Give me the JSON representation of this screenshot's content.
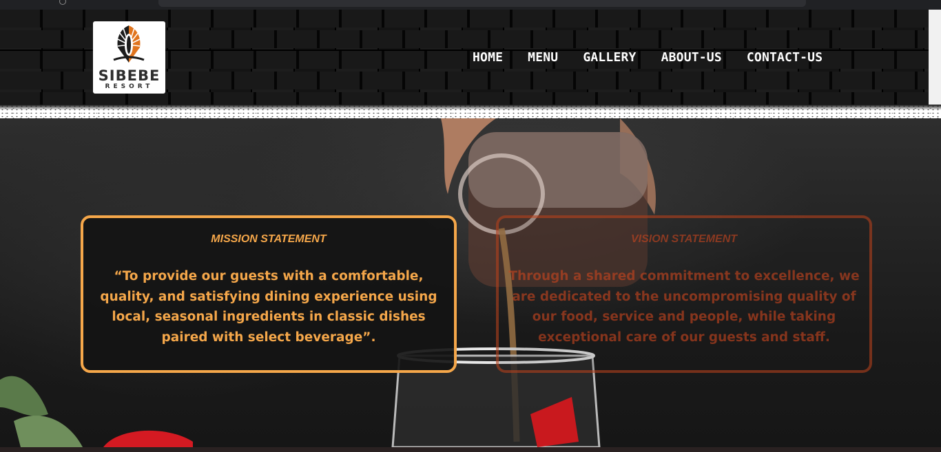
{
  "brand": {
    "name": "SIBEBE",
    "tagline": "RESORT",
    "colors": {
      "orange": "#f5a74a",
      "rust": "#c4461e",
      "dark": "#2d2d2d"
    }
  },
  "nav": {
    "items": [
      {
        "label": "HOME"
      },
      {
        "label": "MENU"
      },
      {
        "label": "GALLERY"
      },
      {
        "label": "ABOUT-US"
      },
      {
        "label": "CONTACT-US"
      }
    ]
  },
  "mission": {
    "title": "MISSION STATEMENT",
    "text": "“To provide our guests with a comfortable, quality, and satisfying dining experience using local, seasonal ingredients in classic dishes paired with select beverage”."
  },
  "vision": {
    "title": "VISION STATEMENT",
    "text": "Through a shared commitment to excellence, we are dedicated to the uncompromising quality of our food, service and people, while taking exceptional care of our guests and staff."
  },
  "hero": {
    "image": "pouring-drink-into-wine-glass-photo",
    "flower": "red-rose-photo"
  }
}
